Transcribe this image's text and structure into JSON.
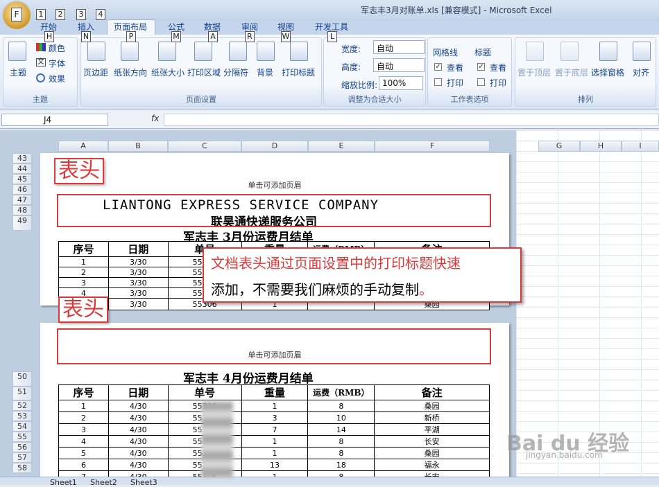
{
  "window": {
    "title": "军志丰3月对账单.xls  [兼容模式] - Microsoft Excel"
  },
  "keytips": [
    "F",
    "1",
    "2",
    "3",
    "4",
    "H",
    "N",
    "P",
    "M",
    "A",
    "R",
    "W",
    "L"
  ],
  "tabs": [
    "开始",
    "插入",
    "页面布局",
    "公式",
    "数据",
    "审阅",
    "视图",
    "开发工具"
  ],
  "ribbon": {
    "theme": {
      "label": "主题",
      "buttons": [
        "主题",
        "颜色",
        "字体",
        "效果"
      ]
    },
    "page_setup": {
      "label": "页面设置",
      "buttons": [
        "页边距",
        "纸张方向",
        "纸张大小",
        "打印区域",
        "分隔符",
        "背景",
        "打印标题"
      ]
    },
    "scale": {
      "label": "调整为合适大小",
      "width_label": "宽度:",
      "width_value": "自动",
      "height_label": "高度:",
      "height_value": "自动",
      "zoom_label": "缩放比例:",
      "zoom_value": "100%"
    },
    "sheet_options": {
      "label": "工作表选项",
      "gridlines": "网格线",
      "headings": "标题",
      "view": "查看",
      "print": "打印"
    },
    "arrange": {
      "label": "排列",
      "buttons": [
        "置于顶层",
        "置于底层",
        "选择窗格",
        "对齐"
      ]
    }
  },
  "formula": {
    "name_box": "J4",
    "fx": "fx"
  },
  "columns": [
    "A",
    "B",
    "C",
    "D",
    "E",
    "F",
    "G",
    "H",
    "I"
  ],
  "rows_top": [
    "43",
    "44",
    "45",
    "46",
    "47",
    "48",
    "49"
  ],
  "rows_bottom": [
    "50",
    "51",
    "52",
    "53",
    "54",
    "55",
    "56",
    "57",
    "58"
  ],
  "annotation": {
    "label1": "表头",
    "label2": "表头",
    "callout_part1": "文档表头通过页面设置中的打印标题快速",
    "callout_part2": "添加，不需要我们麻烦的手动复制",
    "callout_end": "。"
  },
  "page1": {
    "header_hint": "单击可添加页眉",
    "company_en": "LIANTONG    EXPRESS    SERVICE    COMPANY",
    "company_cn": "联昊通快递服务公司",
    "title": "军志丰     3月份运费月结单",
    "headers": [
      "序号",
      "日期",
      "单号",
      "重量",
      "运费（RMB）",
      "备注"
    ],
    "rows": [
      [
        "1",
        "3/30",
        "55306",
        "",
        "",
        ""
      ],
      [
        "2",
        "3/30",
        "55306",
        "",
        "",
        ""
      ],
      [
        "3",
        "3/30",
        "55306",
        "",
        "",
        ""
      ],
      [
        "4",
        "3/30",
        "55306",
        "",
        "",
        ""
      ],
      [
        "5",
        "3/30",
        "55306",
        "1",
        "",
        "桑园"
      ]
    ]
  },
  "page2": {
    "header_hint": "单击可添加页眉",
    "title": "军志丰     4月份运费月结单",
    "headers": [
      "序号",
      "日期",
      "单号",
      "重量",
      "运费（RMB）",
      "备注"
    ],
    "rows": [
      [
        "1",
        "4/30",
        "55306",
        "1",
        "8",
        "桑园"
      ],
      [
        "2",
        "4/30",
        "55306",
        "3",
        "10",
        "新桥"
      ],
      [
        "3",
        "4/30",
        "55306",
        "7",
        "14",
        "平湖"
      ],
      [
        "4",
        "4/30",
        "55306",
        "1",
        "8",
        "长安"
      ],
      [
        "5",
        "4/30",
        "55306",
        "1",
        "8",
        "桑园"
      ],
      [
        "6",
        "4/30",
        "55306",
        "13",
        "18",
        "福永"
      ],
      [
        "7",
        "4/30",
        "55306",
        "1",
        "8",
        "长安"
      ]
    ]
  },
  "sheets": [
    "Sheet1",
    "Sheet2",
    "Sheet3"
  ],
  "watermark": {
    "brand": "Bai du 经验",
    "url": "jingyan.baidu.com"
  }
}
